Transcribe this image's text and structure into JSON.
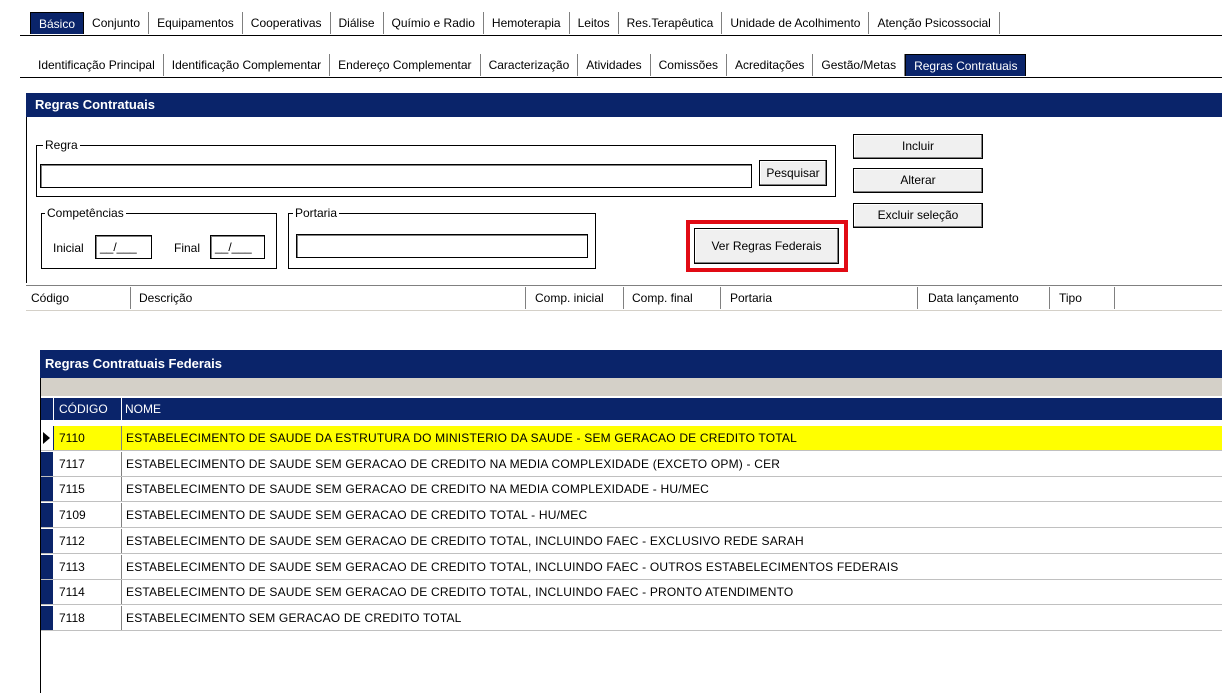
{
  "tabs_row1": [
    "Básico",
    "Conjunto",
    "Equipamentos",
    "Cooperativas",
    "Diálise",
    "Químio e Radio",
    "Hemoterapia",
    "Leitos",
    "Res.Terapêutica",
    "Unidade de Acolhimento",
    "Atenção Psicossocial"
  ],
  "tabs_row2": [
    "Identificação Principal",
    "Identificação Complementar",
    "Endereço Complementar",
    "Caracterização",
    "Atividades",
    "Comissões",
    "Acreditações",
    "Gestão/Metas",
    "Regras Contratuais"
  ],
  "panel": {
    "title": "Regras Contratuais",
    "regra_label": "Regra",
    "regra_value": "",
    "pesquisar_button": "Pesquisar",
    "incluir_button": "Incluir",
    "alterar_button": "Alterar",
    "excluir_button": "Excluir seleção",
    "competencias_label": "Competências",
    "inicial_label": "Inicial",
    "inicial_value": "__/___",
    "final_label": "Final",
    "final_value": "__/___",
    "portaria_label": "Portaria",
    "portaria_value": "",
    "ver_regras_button": "Ver Regras Federais"
  },
  "columns": [
    "Código",
    "Descrição",
    "Comp. inicial",
    "Comp. final",
    "Portaria",
    "Data lançamento",
    "Tipo"
  ],
  "federal": {
    "title": "Regras Contratuais Federais",
    "header_code": "CÓDIGO",
    "header_name": "NOME",
    "rows": [
      {
        "code": "7110",
        "name": "ESTABELECIMENTO DE SAUDE DA ESTRUTURA DO MINISTERIO DA SAUDE - SEM GERACAO DE CREDITO TOTAL"
      },
      {
        "code": "7117",
        "name": "ESTABELECIMENTO DE SAUDE SEM GERACAO DE CREDITO NA MEDIA COMPLEXIDADE (EXCETO OPM) - CER"
      },
      {
        "code": "7115",
        "name": "ESTABELECIMENTO DE SAUDE SEM GERACAO DE CREDITO NA MEDIA COMPLEXIDADE - HU/MEC"
      },
      {
        "code": "7109",
        "name": "ESTABELECIMENTO DE SAUDE SEM GERACAO DE CREDITO TOTAL - HU/MEC"
      },
      {
        "code": "7112",
        "name": "ESTABELECIMENTO DE SAUDE SEM GERACAO DE CREDITO TOTAL, INCLUINDO FAEC - EXCLUSIVO REDE SARAH"
      },
      {
        "code": "7113",
        "name": "ESTABELECIMENTO DE SAUDE SEM GERACAO DE CREDITO TOTAL, INCLUINDO FAEC - OUTROS ESTABELECIMENTOS FEDERAIS"
      },
      {
        "code": "7114",
        "name": "ESTABELECIMENTO DE SAUDE SEM GERACAO DE CREDITO TOTAL, INCLUINDO FAEC - PRONTO ATENDIMENTO"
      },
      {
        "code": "7118",
        "name": "ESTABELECIMENTO SEM GERACAO DE CREDITO TOTAL"
      }
    ],
    "selected_index": 0
  },
  "colors": {
    "title_bar": "#0a246a",
    "selection": "#ffff00",
    "highlight_box": "#e10a14"
  }
}
